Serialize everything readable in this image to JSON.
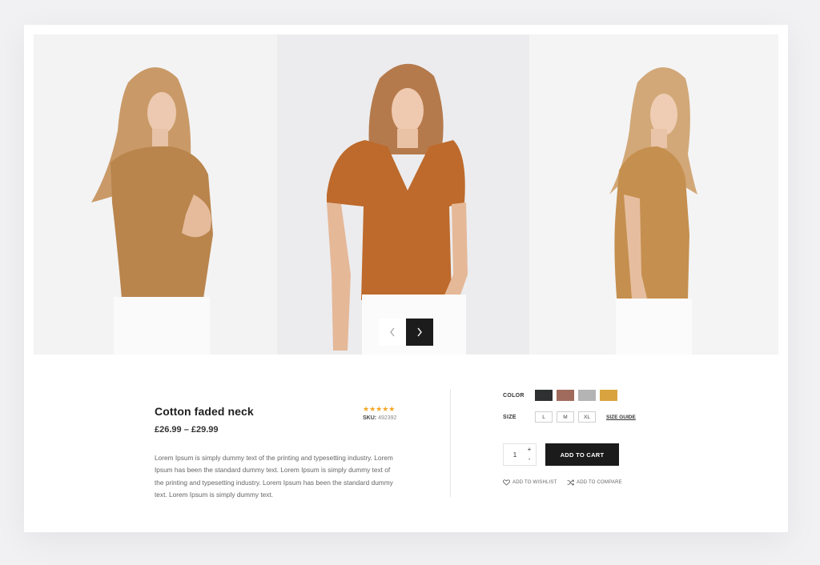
{
  "gallery": {
    "prev_icon": "chevron-left-icon",
    "next_icon": "chevron-right-icon"
  },
  "product": {
    "title": "Cotton faded neck",
    "price": "£26.99 – £29.99",
    "rating": 5,
    "stars": "★★★★★",
    "sku_label": "SKU:",
    "sku_value": "492392",
    "description": "Lorem Ipsum is simply dummy text of the printing and typesetting industry. Lorem Ipsum has been the standard dummy text. Lorem Ipsum is simply dummy text of the printing and typesetting industry. Lorem Ipsum has been the standard dummy text. Lorem Ipsum is simply dummy text."
  },
  "options": {
    "color_label": "COLOR",
    "colors": [
      "#2f3032",
      "#a06b5c",
      "#b4b4b4",
      "#d9a43f"
    ],
    "size_label": "SIZE",
    "sizes": [
      "L",
      "M",
      "XL"
    ],
    "size_guide": "SIZE GUIDE"
  },
  "cart": {
    "quantity": "1",
    "plus": "+",
    "minus": "-",
    "add_to_cart": "ADD TO CART",
    "wishlist": "ADD TO WISHLIST",
    "compare": "ADD TO COMPARE"
  },
  "theme": {
    "accent_dark": "#1b1b1b",
    "star_color": "#f5a623",
    "shirt_color": "#c18a4c"
  }
}
